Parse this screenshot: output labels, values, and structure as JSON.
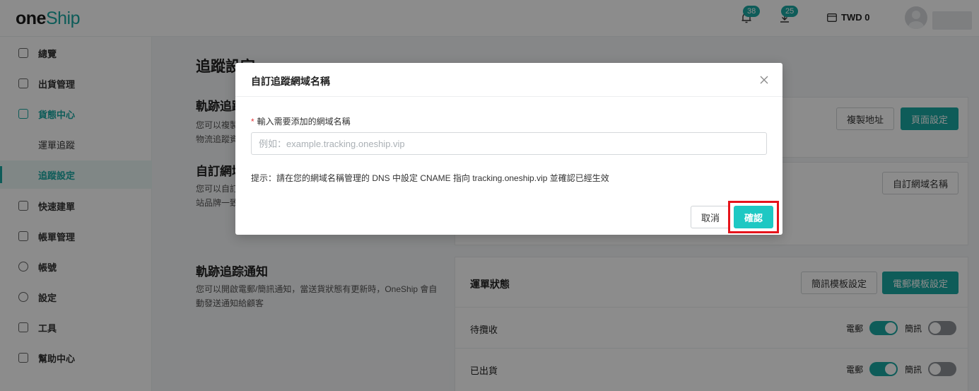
{
  "header": {
    "logo_one": "one",
    "logo_ship": "Ship",
    "notifications_count": "38",
    "downloads_count": "25",
    "wallet_text": "TWD 0"
  },
  "sidebar": {
    "items": [
      {
        "label": "總覽"
      },
      {
        "label": "出貨管理"
      },
      {
        "label": "貨態中心"
      },
      {
        "label": "運單追蹤"
      },
      {
        "label": "追蹤設定"
      },
      {
        "label": "快速建單"
      },
      {
        "label": "帳單管理"
      },
      {
        "label": "帳號"
      },
      {
        "label": "設定"
      },
      {
        "label": "工具"
      },
      {
        "label": "幫助中心"
      }
    ]
  },
  "main": {
    "page_title": "追蹤設定",
    "section1": {
      "title": "軌跡追蹤",
      "desc_line1": "您可以複製",
      "desc_line2": "物流追蹤資",
      "copy_button": "複製地址",
      "page_settings_button": "頁面設定"
    },
    "section2": {
      "title": "自訂網域",
      "desc_line1": "您可以自訂",
      "desc_line2": "站品牌一致",
      "custom_domain_button": "自訂網域名稱"
    },
    "section3": {
      "title": "軌跡追踪通知",
      "desc": "您可以開啟電郵/簡訊通知，當送貨狀態有更新時，OneShip 會自動發送通知給顧客",
      "card_title": "運單狀態",
      "sms_template_button": "簡訊模板設定",
      "email_template_button": "電郵模板設定",
      "rows": [
        {
          "label": "待攬收",
          "email_label": "電郵",
          "sms_label": "簡訊"
        },
        {
          "label": "已出貨",
          "email_label": "電郵",
          "sms_label": "簡訊"
        }
      ]
    }
  },
  "modal": {
    "title": "自訂追蹤網域名稱",
    "field_label": "輸入需要添加的網域名稱",
    "required_mark": "*",
    "input_value": "",
    "input_placeholder": "例如：example.tracking.oneship.vip",
    "hint": "提示：請在您的網域名稱管理的 DNS 中設定 CNAME 指向 tracking.oneship.vip 並確認已經生效",
    "cancel_button": "取消",
    "confirm_button": "確認"
  }
}
